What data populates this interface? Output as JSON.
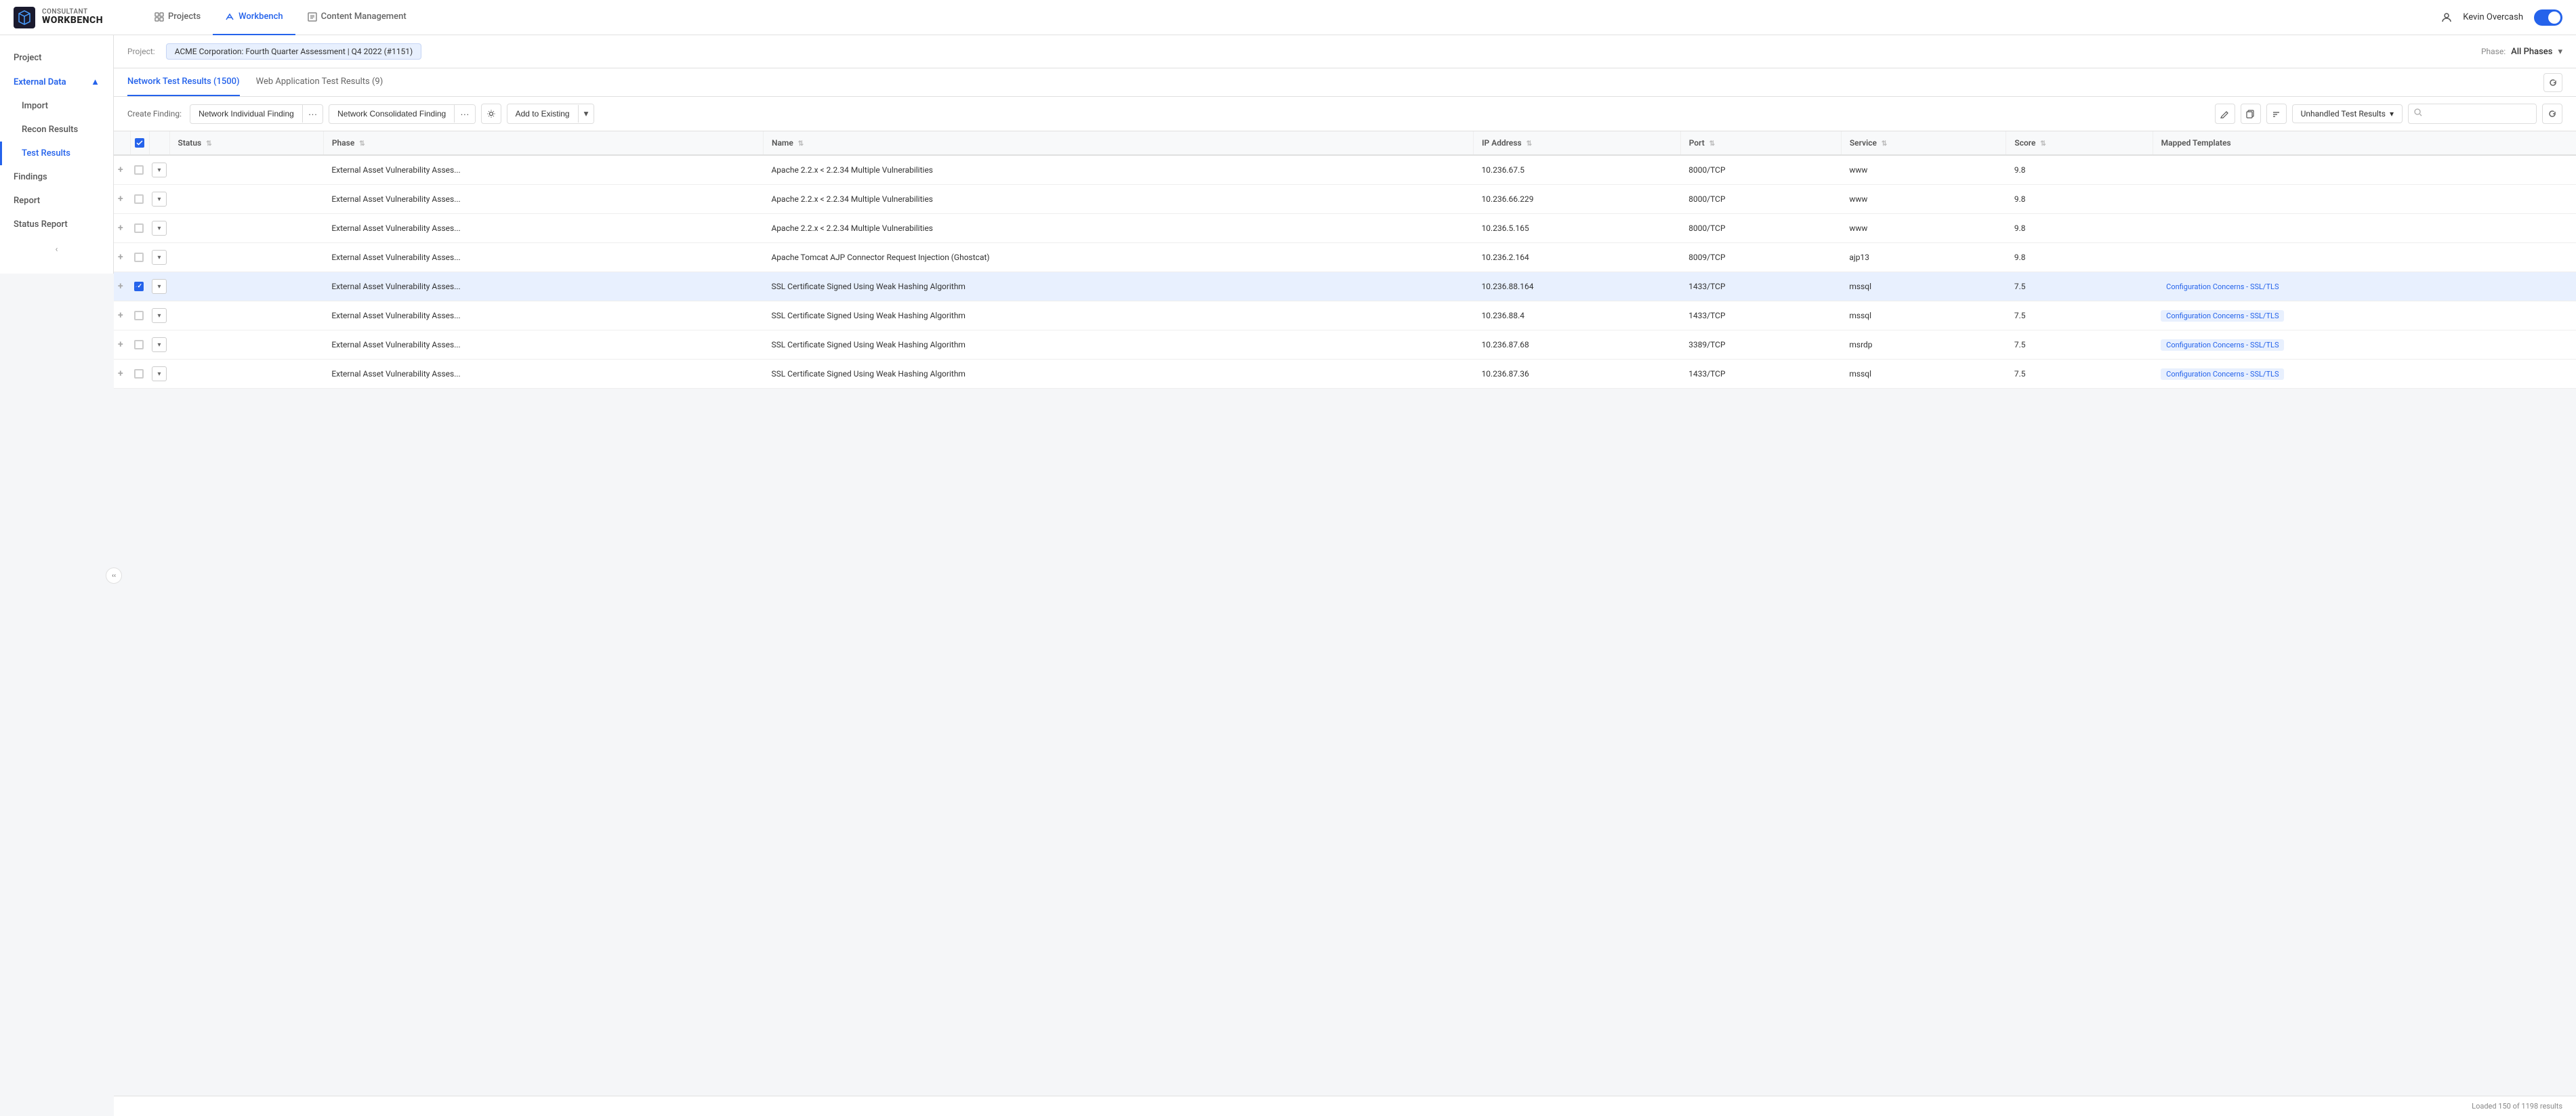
{
  "app": {
    "logo_top": "CONSULTANT",
    "logo_bottom": "WORKBENCH"
  },
  "nav": {
    "tabs": [
      {
        "id": "projects",
        "label": "Projects",
        "active": false
      },
      {
        "id": "workbench",
        "label": "Workbench",
        "active": true
      },
      {
        "id": "content-management",
        "label": "Content Management",
        "active": false
      }
    ],
    "user": "Kevin Overcash"
  },
  "sidebar": {
    "items": [
      {
        "id": "project",
        "label": "Project",
        "indent": 0
      },
      {
        "id": "external-data",
        "label": "External Data",
        "indent": 0,
        "section": true,
        "open": true
      },
      {
        "id": "import",
        "label": "Import",
        "indent": 1
      },
      {
        "id": "recon-results",
        "label": "Recon Results",
        "indent": 1
      },
      {
        "id": "test-results",
        "label": "Test Results",
        "indent": 1,
        "active": true
      },
      {
        "id": "findings",
        "label": "Findings",
        "indent": 0
      },
      {
        "id": "report",
        "label": "Report",
        "indent": 0
      },
      {
        "id": "status-report",
        "label": "Status Report",
        "indent": 0
      }
    ]
  },
  "project_header": {
    "label": "Project:",
    "value": "ACME Corporation: Fourth Quarter Assessment | Q4 2022 (#1151)",
    "phase_label": "Phase:",
    "phase_value": "All Phases"
  },
  "content_tabs": [
    {
      "id": "network-test-results",
      "label": "Network Test Results (1500)",
      "active": true
    },
    {
      "id": "web-app-test-results",
      "label": "Web Application Test Results (9)",
      "active": false
    }
  ],
  "toolbar": {
    "create_finding_label": "Create Finding:",
    "btn_network_individual": "Network Individual Finding",
    "btn_network_consolidated": "Network Consolidated Finding",
    "btn_add_existing": "Add to Existing",
    "filter_label": "Unhandled Test Results",
    "search_placeholder": ""
  },
  "table": {
    "columns": [
      {
        "id": "expand",
        "label": ""
      },
      {
        "id": "select",
        "label": ""
      },
      {
        "id": "dropdown",
        "label": ""
      },
      {
        "id": "status",
        "label": "Status"
      },
      {
        "id": "phase",
        "label": "Phase"
      },
      {
        "id": "name",
        "label": "Name"
      },
      {
        "id": "ip_address",
        "label": "IP Address"
      },
      {
        "id": "port",
        "label": "Port"
      },
      {
        "id": "service",
        "label": "Service"
      },
      {
        "id": "score",
        "label": "Score"
      },
      {
        "id": "mapped_templates",
        "label": "Mapped Templates"
      }
    ],
    "rows": [
      {
        "id": 1,
        "selected": false,
        "status": "",
        "phase": "External Asset Vulnerability Asses...",
        "name": "Apache 2.2.x < 2.2.34 Multiple Vulnerabilities",
        "ip_address": "10.236.67.5",
        "port": "8000/TCP",
        "service": "www",
        "score": "9.8",
        "mapped_templates": ""
      },
      {
        "id": 2,
        "selected": false,
        "status": "",
        "phase": "External Asset Vulnerability Asses...",
        "name": "Apache 2.2.x < 2.2.34 Multiple Vulnerabilities",
        "ip_address": "10.236.66.229",
        "port": "8000/TCP",
        "service": "www",
        "score": "9.8",
        "mapped_templates": ""
      },
      {
        "id": 3,
        "selected": false,
        "status": "",
        "phase": "External Asset Vulnerability Asses...",
        "name": "Apache 2.2.x < 2.2.34 Multiple Vulnerabilities",
        "ip_address": "10.236.5.165",
        "port": "8000/TCP",
        "service": "www",
        "score": "9.8",
        "mapped_templates": ""
      },
      {
        "id": 4,
        "selected": false,
        "status": "",
        "phase": "External Asset Vulnerability Asses...",
        "name": "Apache Tomcat AJP Connector Request Injection (Ghostcat)",
        "ip_address": "10.236.2.164",
        "port": "8009/TCP",
        "service": "ajp13",
        "score": "9.8",
        "mapped_templates": ""
      },
      {
        "id": 5,
        "selected": true,
        "status": "",
        "phase": "External Asset Vulnerability Asses...",
        "name": "SSL Certificate Signed Using Weak Hashing Algorithm",
        "ip_address": "10.236.88.164",
        "port": "1433/TCP",
        "service": "mssql",
        "score": "7.5",
        "mapped_templates": "Configuration Concerns - SSL/TLS"
      },
      {
        "id": 6,
        "selected": false,
        "status": "",
        "phase": "External Asset Vulnerability Asses...",
        "name": "SSL Certificate Signed Using Weak Hashing Algorithm",
        "ip_address": "10.236.88.4",
        "port": "1433/TCP",
        "service": "mssql",
        "score": "7.5",
        "mapped_templates": "Configuration Concerns - SSL/TLS"
      },
      {
        "id": 7,
        "selected": false,
        "status": "",
        "phase": "External Asset Vulnerability Asses...",
        "name": "SSL Certificate Signed Using Weak Hashing Algorithm",
        "ip_address": "10.236.87.68",
        "port": "3389/TCP",
        "service": "msrdp",
        "score": "7.5",
        "mapped_templates": "Configuration Concerns - SSL/TLS"
      },
      {
        "id": 8,
        "selected": false,
        "status": "",
        "phase": "External Asset Vulnerability Asses...",
        "name": "SSL Certificate Signed Using Weak Hashing Algorithm",
        "ip_address": "10.236.87.36",
        "port": "1433/TCP",
        "service": "mssql",
        "score": "7.5",
        "mapped_templates": "Configuration Concerns - SSL/TLS"
      }
    ]
  },
  "footer": {
    "status": "Loaded 150 of 1198 results"
  }
}
